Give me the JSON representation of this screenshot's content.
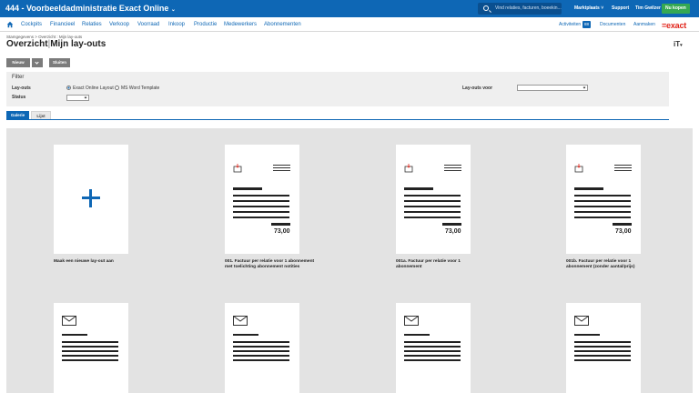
{
  "app": {
    "title": "444 - Voorbeeldadministratie Exact Online",
    "search_placeholder": "Vind relaties, facturen, boeekin...",
    "links": [
      "Marktplaats",
      "Support",
      "Tim Gwilzer"
    ],
    "upgrade": "Nu kopen",
    "brand": "=exact"
  },
  "nav": {
    "items": [
      "Cockpits",
      "Financieel",
      "Relaties",
      "Verkoop",
      "Voorraad",
      "Inkoop",
      "Productie",
      "Medewerkers",
      "Abonnementen"
    ],
    "right": {
      "activiteiten": "Activiteiten",
      "activiteiten_count": "88",
      "documenten": "Documenten",
      "aanmaken": "Aanmaken"
    }
  },
  "page": {
    "breadcrumb": "Stamgegevens > Overzicht : Mijn lay-outs",
    "title_main": "Overzicht",
    "title_sep": "|",
    "title_sub": "Mijn lay-outs",
    "font_icon": "iT"
  },
  "toolbar": {
    "nieuw": "Nieuw",
    "sluiten": "Sluiten"
  },
  "filter": {
    "header": "Filter",
    "layouts_label": "Lay-outs",
    "options": [
      "Exact Online Layout",
      "MS Word Template"
    ],
    "selected_option": 0,
    "status_label": "Status",
    "layouts_voor_label": "Lay-outs voor"
  },
  "tabs": [
    "Galerie",
    "Lijst"
  ],
  "gallery": {
    "cards": [
      {
        "kind": "new",
        "caption": "Maak een nieuwe lay-out aan"
      },
      {
        "kind": "invoice",
        "amount": "73,00",
        "caption": "001. Factuur per relatie voor 1 abonnement met toelichting abonnement notities"
      },
      {
        "kind": "invoice",
        "amount": "73,00",
        "caption": "001a. Factuur per relatie voor 1 abonnement"
      },
      {
        "kind": "invoice",
        "amount": "73,00",
        "caption": "001b. Factuur per relatie voor 1 abonnement (zonder aantal/prijs)"
      },
      {
        "kind": "mail"
      },
      {
        "kind": "mail"
      },
      {
        "kind": "mail"
      },
      {
        "kind": "mail"
      }
    ]
  },
  "colors": {
    "brand_blue": "#0e67b5",
    "exact_red": "#e1251b",
    "upgrade_green": "#35a852",
    "gallery_bg": "#e3e3e3"
  }
}
